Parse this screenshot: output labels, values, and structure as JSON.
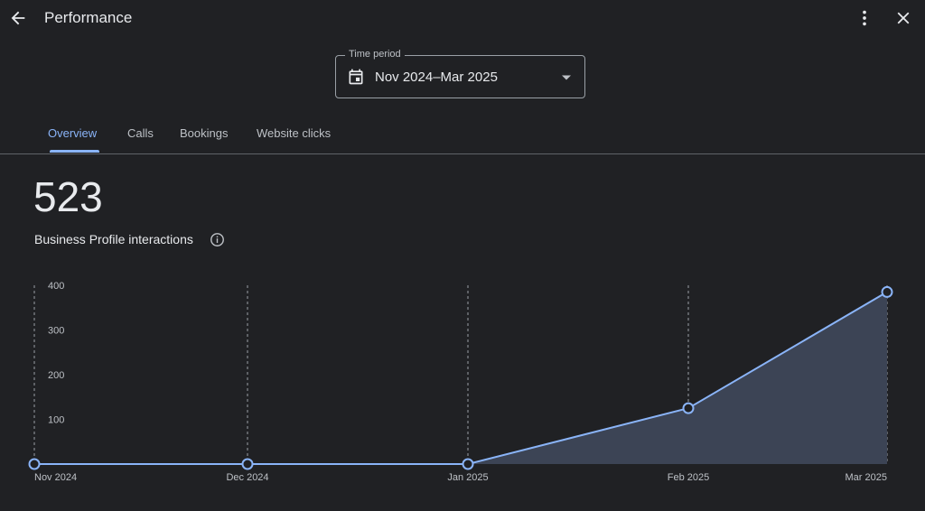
{
  "header": {
    "title": "Performance"
  },
  "time_period": {
    "label": "Time period",
    "value": "Nov 2024–Mar 2025"
  },
  "tabs": [
    {
      "label": "Overview",
      "active": true
    },
    {
      "label": "Calls",
      "active": false
    },
    {
      "label": "Bookings",
      "active": false
    },
    {
      "label": "Website clicks",
      "active": false
    }
  ],
  "summary": {
    "total": "523",
    "label": "Business Profile interactions"
  },
  "icons": [
    "arrow-back-icon",
    "more-vert-icon",
    "close-icon",
    "calendar-icon",
    "dropdown-caret-icon",
    "info-icon"
  ],
  "colors": {
    "background": "#202124",
    "accent": "#8ab4f8",
    "area_fill": "#3c4455"
  },
  "chart_data": {
    "type": "area",
    "categories": [
      "Nov 2024",
      "Dec 2024",
      "Jan 2025",
      "Feb 2025",
      "Mar 2025"
    ],
    "values": [
      0,
      0,
      0,
      125,
      385
    ],
    "y_ticks": [
      "100",
      "200",
      "300",
      "400"
    ],
    "ylim": [
      0,
      400
    ],
    "grid": "vertical dashed"
  }
}
